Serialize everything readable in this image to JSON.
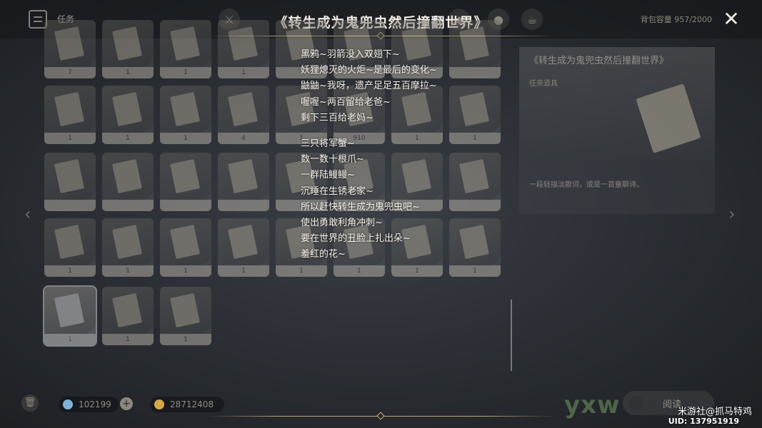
{
  "header": {
    "tab_label": "任务",
    "capacity_text": "背包容量 957/2000",
    "close_label": "✕"
  },
  "title": "《转生成为鬼兜虫然后撞翻世界》",
  "poem": {
    "stanza1": [
      "黑鸦~羽箭没入双翅下~",
      "妖狸熄灭的火炬~是最后的变化~",
      "鼬鼬~我呀，遗产足足五百摩拉~",
      "喔喔~两百留给老爸~",
      "剩下三百给老妈~"
    ],
    "stanza2": [
      "三只将军蟹~",
      "数一数十根爪~",
      "一群陆鳗鳗~",
      "沉睡在生锈老家~",
      "所以赶快转生成为鬼兜虫吧~",
      "使出勇敢利角冲刺~",
      "要在世界的丑脸上扎出朵~",
      "羞红的花~"
    ]
  },
  "inventory": {
    "row0_counts": [
      "7",
      "1",
      "1",
      "1",
      "",
      "",
      "",
      ""
    ],
    "row1_counts": [
      "1",
      "1",
      "1",
      "4",
      "1",
      "910",
      "1",
      "1"
    ],
    "row2_counts": [
      "",
      "",
      "",
      "",
      "",
      "",
      "",
      ""
    ],
    "row3_counts": [
      "1",
      "1",
      "1",
      "1",
      "1",
      "1",
      "1",
      "1"
    ],
    "row4_counts": [
      "1",
      "1",
      "1"
    ]
  },
  "detail": {
    "name": "《转生成为鬼兜虫然后撞翻世界》",
    "type": "任务道具",
    "description": "一段轻描淡歌词，或是一首童聊诗。"
  },
  "footer": {
    "primogem_value": "102199",
    "mora_value": "28712408",
    "read_label": "阅读",
    "watermark_source": "米游社@抓马特鸡",
    "watermark_uid": "UID: 137951919"
  },
  "colors": {
    "accent_gold": "#b9a678",
    "title_text": "#f3efe6"
  }
}
